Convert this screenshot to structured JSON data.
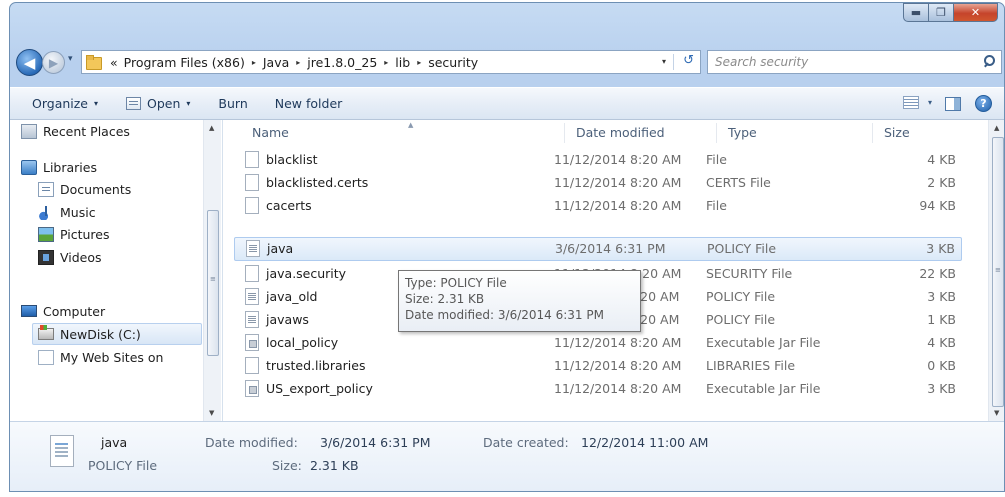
{
  "window": {
    "caption_buttons": {
      "minimize": "▬",
      "maximize": "❐",
      "close": "✕"
    }
  },
  "navigation": {
    "back_glyph": "◀",
    "forward_glyph": "▶",
    "recent_glyph": "▾",
    "breadcrumb_prefix": "«",
    "breadcrumbs": [
      "Program Files (x86)",
      "Java",
      "jre1.8.0_25",
      "lib",
      "security"
    ],
    "crumb_separator": "▸",
    "dropdown_glyph": "▾",
    "refresh_glyph": "↺"
  },
  "search": {
    "placeholder": "Search security"
  },
  "toolbar": {
    "organize": "Organize",
    "open": "Open",
    "burn": "Burn",
    "new_folder": "New folder",
    "dropdown_glyph": "▾",
    "help_glyph": "?"
  },
  "nav_pane": {
    "items": [
      {
        "label": "Recent Places",
        "icon": "recent-places-icon"
      },
      {
        "label": "Libraries",
        "icon": "libraries-icon"
      },
      {
        "label": "Documents",
        "icon": "documents-icon"
      },
      {
        "label": "Music",
        "icon": "music-icon"
      },
      {
        "label": "Pictures",
        "icon": "pictures-icon"
      },
      {
        "label": "Videos",
        "icon": "videos-icon"
      },
      {
        "label": "Computer",
        "icon": "computer-icon"
      },
      {
        "label": "NewDisk (C:)",
        "icon": "disk-icon"
      },
      {
        "label": "My Web Sites on",
        "icon": "web-sites-icon"
      }
    ],
    "scroll_up": "▲",
    "scroll_down": "▼",
    "thumb_grip": "≡"
  },
  "columns": {
    "name": "Name",
    "date": "Date modified",
    "type": "Type",
    "size": "Size",
    "sort_caret": "▲"
  },
  "files": [
    {
      "name": "blacklist",
      "date": "11/12/2014 8:20 AM",
      "type": "File",
      "size": "4 KB"
    },
    {
      "name": "blacklisted.certs",
      "date": "11/12/2014 8:20 AM",
      "type": "CERTS File",
      "size": "2 KB"
    },
    {
      "name": "cacerts",
      "date": "11/12/2014 8:20 AM",
      "type": "File",
      "size": "94 KB"
    },
    {
      "name": "java",
      "date": "3/6/2014 6:31 PM",
      "type": "POLICY File",
      "size": "3 KB"
    },
    {
      "name": "java.security",
      "date": "11/12/2014 8:20 AM",
      "type": "SECURITY File",
      "size": "22 KB"
    },
    {
      "name": "java_old",
      "date": "8:20 AM",
      "type": "POLICY File",
      "size": "3 KB"
    },
    {
      "name": "javaws",
      "date": "8:20 AM",
      "type": "POLICY File",
      "size": "1 KB"
    },
    {
      "name": "local_policy",
      "date": "11/12/2014 8:20 AM",
      "type": "Executable Jar File",
      "size": "4 KB"
    },
    {
      "name": "trusted.libraries",
      "date": "11/12/2014 8:20 AM",
      "type": "LIBRARIES File",
      "size": "0 KB"
    },
    {
      "name": "US_export_policy",
      "date": "11/12/2014 8:20 AM",
      "type": "Executable Jar File",
      "size": "3 KB"
    }
  ],
  "file_scroll": {
    "up": "▲",
    "down": "▼",
    "grip": "≡"
  },
  "tooltip": {
    "type": "Type: POLICY File",
    "size": "Size: 2.31 KB",
    "date": "Date modified: 3/6/2014 6:31 PM"
  },
  "details": {
    "name": "java",
    "type": "POLICY File",
    "date_modified_label": "Date modified:",
    "date_modified": "3/6/2014 6:31 PM",
    "size_label": "Size:",
    "size": "2.31 KB",
    "date_created_label": "Date created:",
    "date_created": "12/2/2014 11:00 AM"
  }
}
